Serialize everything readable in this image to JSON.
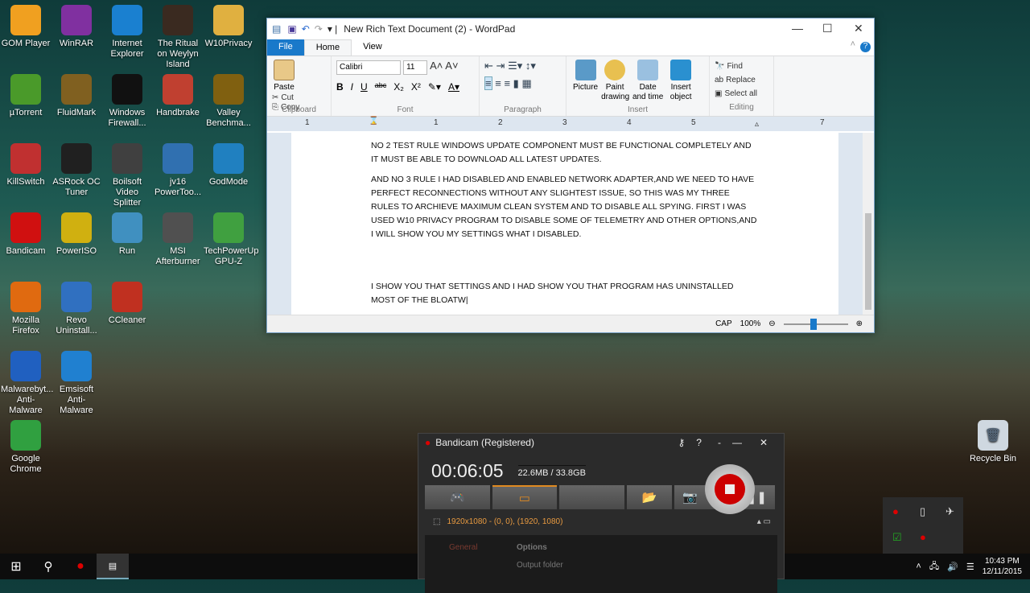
{
  "desktop": {
    "icons": [
      {
        "label": "GOM Player",
        "color": "#f0a020"
      },
      {
        "label": "µTorrent",
        "color": "#4a9a2a"
      },
      {
        "label": "KillSwitch",
        "color": "#c03030"
      },
      {
        "label": "Bandicam",
        "color": "#d01010"
      },
      {
        "label": "Mozilla Firefox",
        "color": "#e06a10"
      },
      {
        "label": "Malwarebyt... Anti-Malware",
        "color": "#2060c0"
      },
      {
        "label": "Google Chrome",
        "color": "#30a040"
      },
      {
        "label": "WinRAR",
        "color": "#8030a0"
      },
      {
        "label": "FluidMark",
        "color": "#806020"
      },
      {
        "label": "ASRock OC Tuner",
        "color": "#202020"
      },
      {
        "label": "PowerISO",
        "color": "#d0b010"
      },
      {
        "label": "Revo Uninstall...",
        "color": "#3070c0"
      },
      {
        "label": "Emsisoft Anti-Malware",
        "color": "#2080d0"
      },
      {
        "label": "Internet Explorer",
        "color": "#1a80d0"
      },
      {
        "label": "Windows Firewall...",
        "color": "#111111"
      },
      {
        "label": "Boilsoft Video Splitter",
        "color": "#404040"
      },
      {
        "label": "Run",
        "color": "#4090c0"
      },
      {
        "label": "CCleaner",
        "color": "#c03020"
      },
      {
        "label": "The Ritual on Weylyn Island",
        "color": "#3a2a20"
      },
      {
        "label": "Handbrake",
        "color": "#c04030"
      },
      {
        "label": "jv16 PowerToo...",
        "color": "#3070b0"
      },
      {
        "label": "MSI Afterburner",
        "color": "#505050"
      },
      {
        "label": "W10Privacy",
        "color": "#e0b040"
      },
      {
        "label": "Valley Benchma...",
        "color": "#806010"
      },
      {
        "label": "GodMode",
        "color": "#2080c0"
      },
      {
        "label": "TechPowerUp GPU-Z",
        "color": "#40a040"
      }
    ],
    "recycle_bin": "Recycle Bin"
  },
  "wordpad": {
    "title": "New Rich Text Document (2) - WordPad",
    "tabs": [
      "File",
      "Home",
      "View"
    ],
    "clipboard": {
      "paste": "Paste",
      "cut": "Cut",
      "copy": "Copy",
      "label": "Clipboard"
    },
    "font": {
      "family": "Calibri",
      "size": "11",
      "label": "Font",
      "bold": "B",
      "italic": "I",
      "underline": "U",
      "strike": "abc",
      "sub": "X₂",
      "sup": "X²"
    },
    "paragraph": {
      "label": "Paragraph"
    },
    "insert": {
      "picture": "Picture",
      "paint": "Paint drawing",
      "datetime": "Date and time",
      "object": "Insert object",
      "label": "Insert"
    },
    "editing": {
      "find": "Find",
      "replace": "Replace",
      "select_all": "Select all",
      "label": "Editing"
    },
    "ruler": [
      "1",
      "1",
      "2",
      "3",
      "4",
      "5",
      "7"
    ],
    "paragraphs": [
      "NO 2 TEST RULE WINDOWS UPDATE COMPONENT MUST BE FUNCTIONAL COMPLETELY AND IT MUST BE ABLE TO DOWNLOAD ALL LATEST UPDATES.",
      "AND NO 3 RULE I HAD DISABLED AND ENABLED NETWORK ADAPTER,AND WE NEED TO HAVE PERFECT RECONNECTIONS WITHOUT ANY SLIGHTEST ISSUE, SO THIS WAS MY THREE RULES TO ARCHIEVE MAXIMUM CLEAN SYSTEM AND TO DISABLE ALL SPYING. FIRST I WAS USED W10 PRIVACY PROGRAM TO DISABLE SOME OF TELEMETRY AND OTHER OPTIONS,AND I WILL SHOW YOU MY SETTINGS WHAT I DISABLED.",
      "I SHOW YOU THAT SETTINGS AND I HAD SHOW YOU THAT PROGRAM HAS UNINSTALLED MOST OF THE BLOATW"
    ],
    "status": {
      "caps": "CAP",
      "zoom": "100%",
      "zoom_value": 100
    }
  },
  "bandicam": {
    "title": "Bandicam (Registered)",
    "time": "00:06:05",
    "size": "22.6MB / 33.8GB",
    "region": "1920x1080 - (0, 0), (1920, 1080)",
    "tab_general": "General",
    "tab_options": "Options",
    "output": "Output folder"
  },
  "taskbar": {
    "time": "10:43 PM",
    "date": "12/11/2015"
  }
}
